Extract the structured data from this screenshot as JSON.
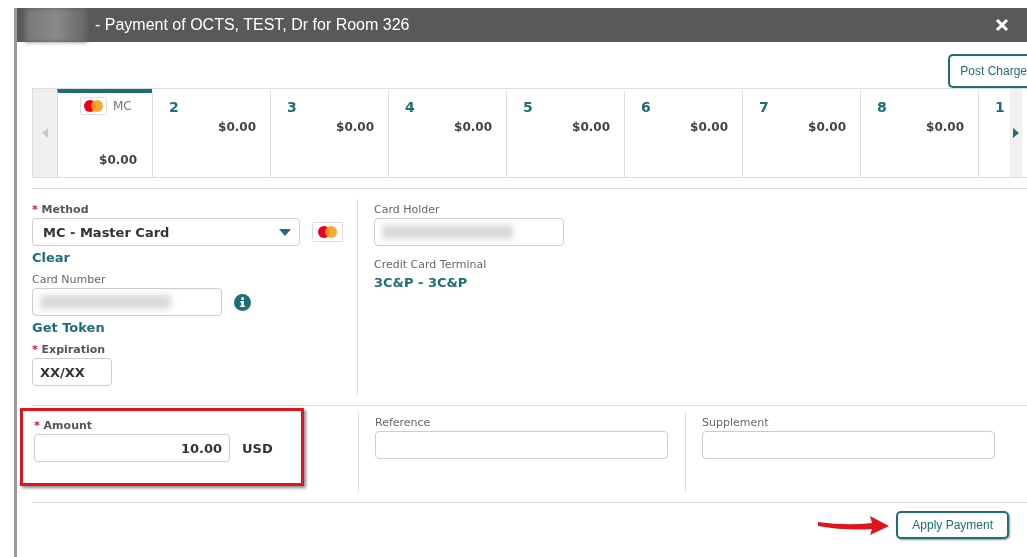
{
  "window": {
    "title": "- Payment of OCTS, TEST, Dr for Room 326",
    "title_redacted": true
  },
  "toolbar": {
    "post_charges": "Post Charge"
  },
  "tabs": [
    {
      "kind": "card",
      "label": "MC",
      "amount": "$0.00",
      "selected": true
    },
    {
      "kind": "number",
      "label": "2",
      "amount": "$0.00",
      "selected": false
    },
    {
      "kind": "number",
      "label": "3",
      "amount": "$0.00",
      "selected": false
    },
    {
      "kind": "number",
      "label": "4",
      "amount": "$0.00",
      "selected": false
    },
    {
      "kind": "number",
      "label": "5",
      "amount": "$0.00",
      "selected": false
    },
    {
      "kind": "number",
      "label": "6",
      "amount": "$0.00",
      "selected": false
    },
    {
      "kind": "number",
      "label": "7",
      "amount": "$0.00",
      "selected": false
    },
    {
      "kind": "number",
      "label": "8",
      "amount": "$0.00",
      "selected": false
    },
    {
      "kind": "partial",
      "label": "1",
      "selected": false
    }
  ],
  "method": {
    "required_mark": "*",
    "label": "Method",
    "value": "MC - Master Card",
    "clear": "Clear"
  },
  "card_number": {
    "label": "Card Number",
    "redacted": true,
    "get_token": "Get Token"
  },
  "expiration": {
    "required_mark": "*",
    "label": "Expiration",
    "value": "XX/XX"
  },
  "card_holder": {
    "label": "Card Holder",
    "redacted": true
  },
  "terminal": {
    "label": "Credit Card Terminal",
    "value": "3C&P - 3C&P"
  },
  "amount": {
    "required_mark": "*",
    "label": "Amount",
    "value": "10.00",
    "currency": "USD",
    "highlighted": true
  },
  "reference": {
    "label": "Reference"
  },
  "supplement": {
    "label": "Supplement"
  },
  "apply": {
    "label": "Apply Payment",
    "pointed": true
  }
}
